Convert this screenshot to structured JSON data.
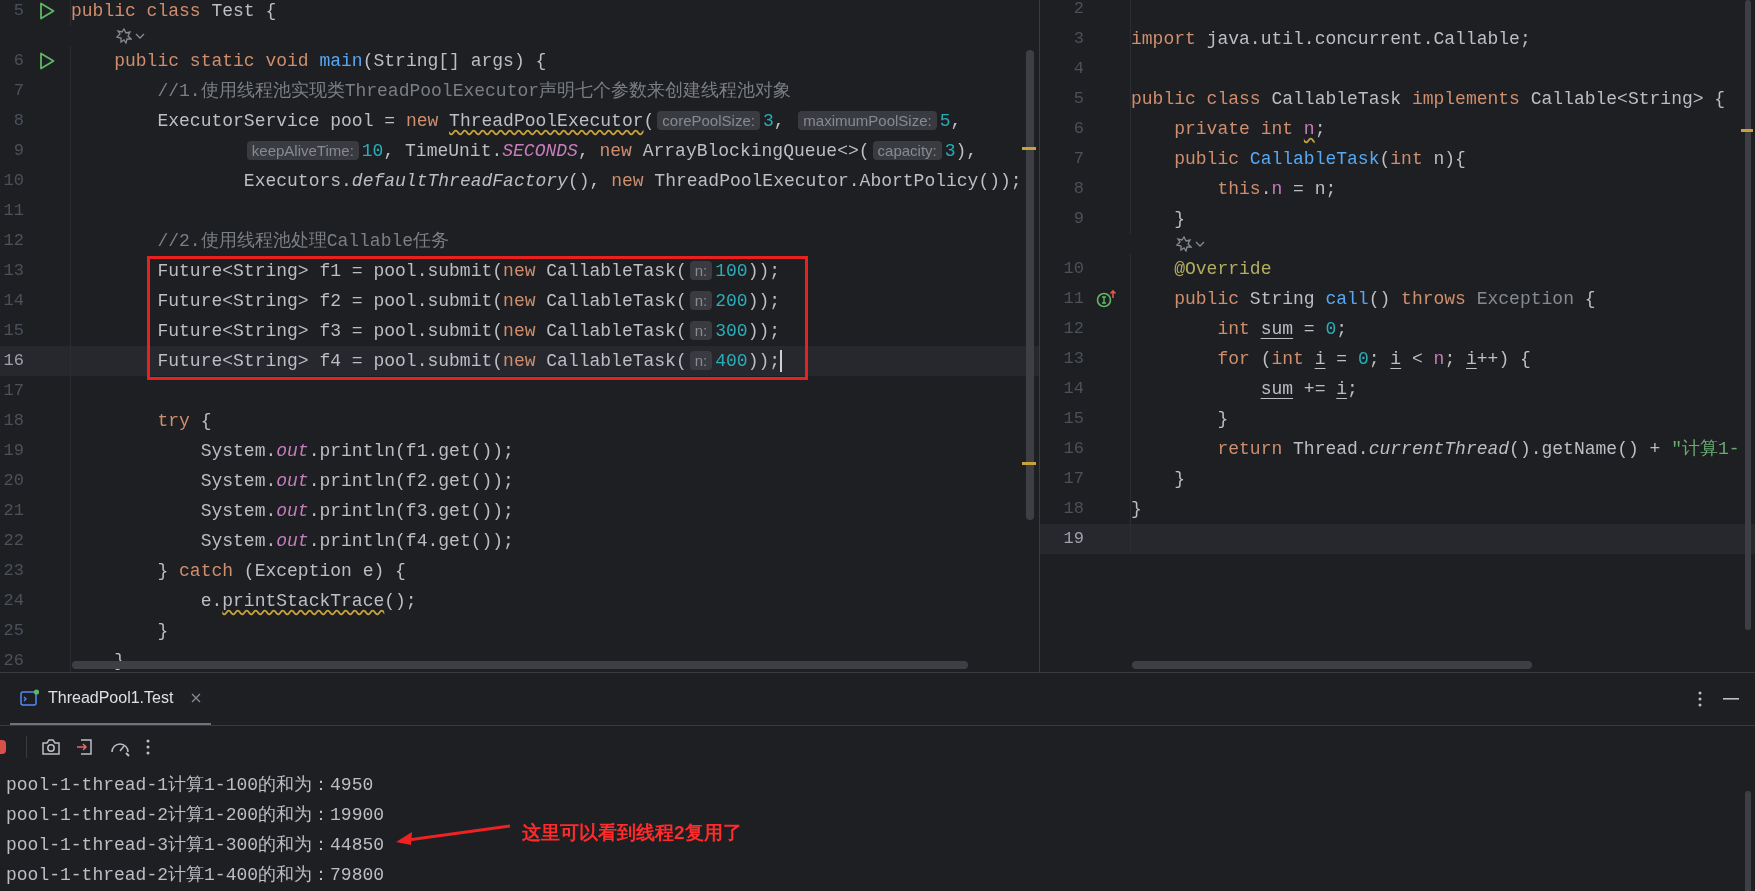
{
  "left_editor": {
    "focused": true,
    "lines": [
      {
        "kind": "code",
        "number": "5",
        "gutter_icon": {
          "kind": "run"
        },
        "current": false,
        "boxed": false,
        "tokens": [
          {
            "text": "public class ",
            "kind": "kw"
          },
          {
            "text": "Test {",
            "kind": "plain"
          }
        ]
      },
      {
        "kind": "inlay_icon"
      },
      {
        "kind": "code",
        "number": "6",
        "gutter_icon": {
          "kind": "run"
        },
        "current": false,
        "boxed": false,
        "tokens": [
          {
            "text": "    public static void ",
            "kind": "kw"
          },
          {
            "text": "main",
            "kind": "fn"
          },
          {
            "text": "(String[] args) {",
            "kind": "plain"
          }
        ]
      },
      {
        "kind": "code",
        "number": "7",
        "current": false,
        "boxed": false,
        "tokens": [
          {
            "text": "        //1.使用线程池实现类ThreadPoolExecutor声明七个参数来创建线程池对象",
            "kind": "cmt"
          }
        ]
      },
      {
        "kind": "code",
        "number": "8",
        "current": false,
        "boxed": false,
        "tokens": [
          {
            "text": "        ExecutorService pool = ",
            "kind": "plain"
          },
          {
            "text": "new ",
            "kind": "kw"
          },
          {
            "text": "ThreadPoolExecutor",
            "kind": "warn"
          },
          {
            "text": "(",
            "kind": "plain"
          },
          {
            "text": "corePoolSize:",
            "kind": "hint"
          },
          {
            "text": "3",
            "kind": "num"
          },
          {
            "text": ", ",
            "kind": "plain"
          },
          {
            "text": "maximumPoolSize:",
            "kind": "hint"
          },
          {
            "text": "5",
            "kind": "num"
          },
          {
            "text": ",",
            "kind": "plain"
          }
        ]
      },
      {
        "kind": "code",
        "number": "9",
        "current": false,
        "boxed": false,
        "tokens": [
          {
            "text": "                keepAliveTime:",
            "kind": "hint"
          },
          {
            "text": "10",
            "kind": "num"
          },
          {
            "text": ", TimeUnit.",
            "kind": "plain"
          },
          {
            "text": "SECONDS",
            "kind": "sfield"
          },
          {
            "text": ", ",
            "kind": "plain"
          },
          {
            "text": "new ",
            "kind": "kw"
          },
          {
            "text": "ArrayBlockingQueue<>(",
            "kind": "plain"
          },
          {
            "text": "capacity:",
            "kind": "hint"
          },
          {
            "text": "3",
            "kind": "num"
          },
          {
            "text": "),",
            "kind": "plain"
          }
        ]
      },
      {
        "kind": "code",
        "number": "10",
        "current": false,
        "boxed": false,
        "tokens": [
          {
            "text": "                Executors.",
            "kind": "plain"
          },
          {
            "text": "defaultThreadFactory",
            "kind": "ifn"
          },
          {
            "text": "(), ",
            "kind": "plain"
          },
          {
            "text": "new ",
            "kind": "kw"
          },
          {
            "text": "ThreadPoolExecutor.AbortPolicy());",
            "kind": "plain"
          }
        ]
      },
      {
        "kind": "code",
        "number": "11",
        "current": false,
        "boxed": false
      },
      {
        "kind": "code",
        "number": "12",
        "current": false,
        "boxed": false,
        "tokens": [
          {
            "text": "        //2.使用线程池处理Callable任务",
            "kind": "cmt"
          }
        ]
      },
      {
        "kind": "code",
        "number": "13",
        "current": false,
        "boxed": true,
        "tokens": [
          {
            "text": "        Future<String> f1 = pool.submit(",
            "kind": "plain"
          },
          {
            "text": "new ",
            "kind": "kw"
          },
          {
            "text": "CallableTask(",
            "kind": "plain"
          },
          {
            "text": "n:",
            "kind": "hint"
          },
          {
            "text": "100",
            "kind": "num"
          },
          {
            "text": "));",
            "kind": "plain"
          }
        ]
      },
      {
        "kind": "code",
        "number": "14",
        "current": false,
        "boxed": true,
        "tokens": [
          {
            "text": "        Future<String> f2 = pool.submit(",
            "kind": "plain"
          },
          {
            "text": "new ",
            "kind": "kw"
          },
          {
            "text": "CallableTask(",
            "kind": "plain"
          },
          {
            "text": "n:",
            "kind": "hint"
          },
          {
            "text": "200",
            "kind": "num"
          },
          {
            "text": "));",
            "kind": "plain"
          }
        ]
      },
      {
        "kind": "code",
        "number": "15",
        "current": false,
        "boxed": true,
        "tokens": [
          {
            "text": "        Future<String> f3 = pool.submit(",
            "kind": "plain"
          },
          {
            "text": "new ",
            "kind": "kw"
          },
          {
            "text": "CallableTask(",
            "kind": "plain"
          },
          {
            "text": "n:",
            "kind": "hint"
          },
          {
            "text": "300",
            "kind": "num"
          },
          {
            "text": "));",
            "kind": "plain"
          }
        ]
      },
      {
        "kind": "code",
        "number": "16",
        "current": true,
        "boxed": true,
        "tokens": [
          {
            "text": "        Future<String> f4 = pool.submit(",
            "kind": "plain"
          },
          {
            "text": "new ",
            "kind": "kw"
          },
          {
            "text": "CallableTask(",
            "kind": "plain"
          },
          {
            "text": "n:",
            "kind": "hint"
          },
          {
            "text": "400",
            "kind": "num"
          },
          {
            "text": "));",
            "kind": "plain"
          }
        ]
      },
      {
        "kind": "code",
        "number": "17",
        "current": false,
        "boxed": false
      },
      {
        "kind": "code",
        "number": "18",
        "current": false,
        "boxed": false,
        "tokens": [
          {
            "text": "        try",
            "kind": "kw"
          },
          {
            "text": " {",
            "kind": "plain"
          }
        ]
      },
      {
        "kind": "code",
        "number": "19",
        "current": false,
        "boxed": false,
        "tokens": [
          {
            "text": "            System.",
            "kind": "plain"
          },
          {
            "text": "out",
            "kind": "sfield"
          },
          {
            "text": ".println(f1.get());",
            "kind": "plain"
          }
        ]
      },
      {
        "kind": "code",
        "number": "20",
        "current": false,
        "boxed": false,
        "tokens": [
          {
            "text": "            System.",
            "kind": "plain"
          },
          {
            "text": "out",
            "kind": "sfield"
          },
          {
            "text": ".println(f2.get());",
            "kind": "plain"
          }
        ]
      },
      {
        "kind": "code",
        "number": "21",
        "current": false,
        "boxed": false,
        "tokens": [
          {
            "text": "            System.",
            "kind": "plain"
          },
          {
            "text": "out",
            "kind": "sfield"
          },
          {
            "text": ".println(f3.get());",
            "kind": "plain"
          }
        ]
      },
      {
        "kind": "code",
        "number": "22",
        "current": false,
        "boxed": false,
        "tokens": [
          {
            "text": "            System.",
            "kind": "plain"
          },
          {
            "text": "out",
            "kind": "sfield"
          },
          {
            "text": ".println(f4.get());",
            "kind": "plain"
          }
        ]
      },
      {
        "kind": "code",
        "number": "23",
        "current": false,
        "boxed": false,
        "tokens": [
          {
            "text": "        } ",
            "kind": "plain"
          },
          {
            "text": "catch ",
            "kind": "kw"
          },
          {
            "text": "(Exception e) {",
            "kind": "plain"
          }
        ]
      },
      {
        "kind": "code",
        "number": "24",
        "current": false,
        "boxed": false,
        "tokens": [
          {
            "text": "            e.",
            "kind": "plain"
          },
          {
            "text": "printStackTrace",
            "kind": "warn"
          },
          {
            "text": "();",
            "kind": "plain"
          }
        ]
      },
      {
        "kind": "code",
        "number": "25",
        "current": false,
        "boxed": false,
        "tokens": [
          {
            "text": "        }",
            "kind": "plain"
          }
        ]
      },
      {
        "kind": "code",
        "number": "26",
        "current": false,
        "boxed": false,
        "tokens": [
          {
            "text": "    }",
            "kind": "plain"
          }
        ]
      }
    ]
  },
  "right_editor": {
    "focused": false,
    "lines": [
      {
        "kind": "code",
        "number": "2",
        "current": false
      },
      {
        "kind": "code",
        "number": "3",
        "current": false,
        "tokens": [
          {
            "text": "import ",
            "kind": "kw"
          },
          {
            "text": "java.util.concurrent.Callable;",
            "kind": "plain"
          }
        ]
      },
      {
        "kind": "code",
        "number": "4",
        "current": false
      },
      {
        "kind": "code",
        "number": "5",
        "current": false,
        "tokens": [
          {
            "text": "public class ",
            "kind": "kw"
          },
          {
            "text": "CallableTask ",
            "kind": "plain"
          },
          {
            "text": "implements ",
            "kind": "kw"
          },
          {
            "text": "Callable<String> {",
            "kind": "plain"
          }
        ]
      },
      {
        "kind": "code",
        "number": "6",
        "current": false,
        "tokens": [
          {
            "text": "    private int ",
            "kind": "kw"
          },
          {
            "text": "n",
            "kind": "wfield"
          },
          {
            "text": ";",
            "kind": "plain"
          }
        ]
      },
      {
        "kind": "code",
        "number": "7",
        "current": false,
        "tokens": [
          {
            "text": "    public ",
            "kind": "kw"
          },
          {
            "text": "CallableTask",
            "kind": "fn"
          },
          {
            "text": "(",
            "kind": "plain"
          },
          {
            "text": "int ",
            "kind": "kw"
          },
          {
            "text": "n){",
            "kind": "plain"
          }
        ]
      },
      {
        "kind": "code",
        "number": "8",
        "current": false,
        "tokens": [
          {
            "text": "        this",
            "kind": "kw"
          },
          {
            "text": ".",
            "kind": "plain"
          },
          {
            "text": "n",
            "kind": "field"
          },
          {
            "text": " = n;",
            "kind": "plain"
          }
        ]
      },
      {
        "kind": "code",
        "number": "9",
        "current": false,
        "tokens": [
          {
            "text": "    }",
            "kind": "plain"
          }
        ]
      },
      {
        "kind": "inlay_icon"
      },
      {
        "kind": "code",
        "number": "10",
        "current": false,
        "tokens": [
          {
            "text": "    @Override",
            "kind": "ann"
          }
        ]
      },
      {
        "kind": "code",
        "number": "11",
        "gutter_icon": {
          "kind": "implements"
        },
        "current": false,
        "tokens": [
          {
            "text": "    public ",
            "kind": "kw"
          },
          {
            "text": "String ",
            "kind": "plain"
          },
          {
            "text": "call",
            "kind": "fn"
          },
          {
            "text": "() ",
            "kind": "plain"
          },
          {
            "text": "throws ",
            "kind": "kw"
          },
          {
            "text": "Exception",
            "kind": "dim"
          },
          {
            "text": " {",
            "kind": "plain"
          }
        ]
      },
      {
        "kind": "code",
        "number": "12",
        "current": false,
        "tokens": [
          {
            "text": "        int ",
            "kind": "kw"
          },
          {
            "text": "sum",
            "kind": "var"
          },
          {
            "text": " = ",
            "kind": "plain"
          },
          {
            "text": "0",
            "kind": "num"
          },
          {
            "text": ";",
            "kind": "plain"
          }
        ]
      },
      {
        "kind": "code",
        "number": "13",
        "current": false,
        "tokens": [
          {
            "text": "        for ",
            "kind": "kw"
          },
          {
            "text": "(",
            "kind": "plain"
          },
          {
            "text": "int ",
            "kind": "kw"
          },
          {
            "text": "i",
            "kind": "var"
          },
          {
            "text": " = ",
            "kind": "plain"
          },
          {
            "text": "0",
            "kind": "num"
          },
          {
            "text": "; ",
            "kind": "plain"
          },
          {
            "text": "i",
            "kind": "var"
          },
          {
            "text": " < ",
            "kind": "plain"
          },
          {
            "text": "n",
            "kind": "field"
          },
          {
            "text": "; ",
            "kind": "plain"
          },
          {
            "text": "i",
            "kind": "var"
          },
          {
            "text": "++) {",
            "kind": "plain"
          }
        ]
      },
      {
        "kind": "code",
        "number": "14",
        "current": false,
        "tokens": [
          {
            "text": "            sum",
            "kind": "var"
          },
          {
            "text": " += ",
            "kind": "plain"
          },
          {
            "text": "i",
            "kind": "var"
          },
          {
            "text": ";",
            "kind": "plain"
          }
        ]
      },
      {
        "kind": "code",
        "number": "15",
        "current": false,
        "tokens": [
          {
            "text": "        }",
            "kind": "plain"
          }
        ]
      },
      {
        "kind": "code",
        "number": "16",
        "current": false,
        "tokens": [
          {
            "text": "        return ",
            "kind": "kw"
          },
          {
            "text": "Thread.",
            "kind": "plain"
          },
          {
            "text": "currentThread",
            "kind": "ifn"
          },
          {
            "text": "().getName() + ",
            "kind": "plain"
          },
          {
            "text": "\"计算1-",
            "kind": "str"
          }
        ]
      },
      {
        "kind": "code",
        "number": "17",
        "current": false,
        "tokens": [
          {
            "text": "    }",
            "kind": "plain"
          }
        ]
      },
      {
        "kind": "code",
        "number": "18",
        "current": false,
        "tokens": [
          {
            "text": "}",
            "kind": "plain"
          }
        ]
      },
      {
        "kind": "code",
        "number": "19",
        "current": true
      }
    ]
  },
  "run_panel": {
    "tabs": [
      {
        "label": "ThreadPool1.Test",
        "selected": true
      }
    ],
    "output": [
      "pool-1-thread-1计算1-100的和为：4950",
      "pool-1-thread-2计算1-200的和为：19900",
      "pool-1-thread-3计算1-300的和为：44850",
      "pool-1-thread-2计算1-400的和为：79800"
    ],
    "annotation": {
      "text": "这里可以看到线程2复用了"
    }
  }
}
